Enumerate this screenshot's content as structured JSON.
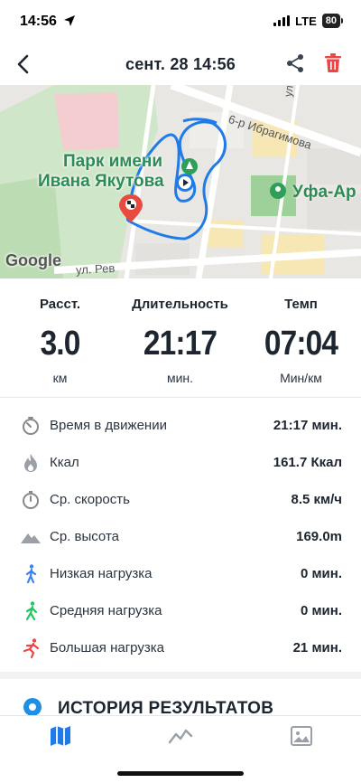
{
  "status_bar": {
    "time": "14:56",
    "network": "LTE",
    "battery": "80"
  },
  "header": {
    "title": "сент. 28  14:56"
  },
  "map": {
    "park_label_line1": "Парк имени",
    "park_label_line2": "Ивана Якутова",
    "place_label": "Уфа-Ар",
    "street_top": "6-р Ибрагимова",
    "street_vertical": "ул. Л",
    "street_bottom": "ул. Рев",
    "provider": "Google",
    "route_color": "#1f7be8"
  },
  "stats": [
    {
      "label": "Расст.",
      "value": "3.0",
      "unit": "км"
    },
    {
      "label": "Длительность",
      "value": "21:17",
      "unit": "мин."
    },
    {
      "label": "Темп",
      "value": "07:04",
      "unit": "Мин/км"
    }
  ],
  "details": [
    {
      "icon": "stopwatch-motion-icon",
      "label": "Время в движении",
      "value": "21:17 мин."
    },
    {
      "icon": "flame-icon",
      "label": "Ккал",
      "value": "161.7 Ккал"
    },
    {
      "icon": "stopwatch-icon",
      "label": "Ср. скорость",
      "value": "8.5 км/ч"
    },
    {
      "icon": "mountain-icon",
      "label": "Ср. высота",
      "value": "169.0m"
    },
    {
      "icon": "walker-icon",
      "label": "Низкая нагрузка",
      "value": "0 мин."
    },
    {
      "icon": "walker-icon",
      "label": "Средняя нагрузка",
      "value": "0 мин."
    },
    {
      "icon": "runner-icon",
      "label": "Большая нагрузка",
      "value": "21 мин."
    }
  ],
  "history": {
    "title": "ИСТОРИЯ РЕЗУЛЬТАТОВ"
  },
  "colors": {
    "accent": "#1f7be8",
    "low_load": "#3b82f6",
    "medium_load": "#22c55e",
    "high_load": "#ef4444",
    "delete": "#ef4444"
  }
}
